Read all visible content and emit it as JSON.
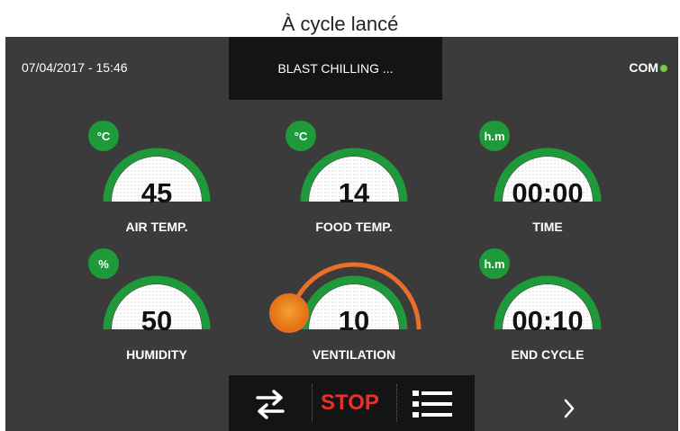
{
  "caption": "À cycle lancé",
  "header": {
    "datetime": "07/04/2017 - 15:46",
    "title": "BLAST CHILLING ...",
    "com_label": "COM",
    "com_status_color": "#7ac943"
  },
  "gauges": [
    {
      "unit": "°C",
      "value": "45",
      "label": "AIR TEMP.",
      "ring_color": "#1e9a3a"
    },
    {
      "unit": "°C",
      "value": "14",
      "label": "FOOD TEMP.",
      "ring_color": "#1e9a3a"
    },
    {
      "unit": "h.m",
      "value": "00:00",
      "label": "TIME",
      "ring_color": "#1e9a3a"
    },
    {
      "unit": "%",
      "value": "50",
      "label": "HUMIDITY",
      "ring_color": "#1e9a3a"
    },
    {
      "unit": "",
      "value": "10",
      "label": "VENTILATION",
      "ring_color": "#e8702a",
      "selected": true
    },
    {
      "unit": "h.m",
      "value": "00:10",
      "label": "END CYCLE",
      "ring_color": "#1e9a3a"
    }
  ],
  "toolbar": {
    "swap_icon": "swap-arrows-icon",
    "stop_label": "STOP",
    "menu_icon": "list-menu-icon",
    "next_icon": "chevron-right-icon",
    "stop_color": "#e8302b"
  }
}
